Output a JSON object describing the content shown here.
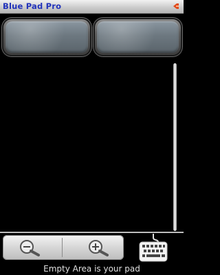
{
  "app": {
    "title": "Blue Pad Pro"
  },
  "icons": {
    "title_icon": "arrow-tag-icon",
    "zoom_out": "zoom-out-icon",
    "zoom_in": "zoom-in-icon",
    "keyboard": "keyboard-icon"
  },
  "footer": {
    "hint": "Empty Area is your pad"
  },
  "colors": {
    "title": "#2233bb",
    "accent_icon": "#e04a1a",
    "background": "#000000"
  }
}
